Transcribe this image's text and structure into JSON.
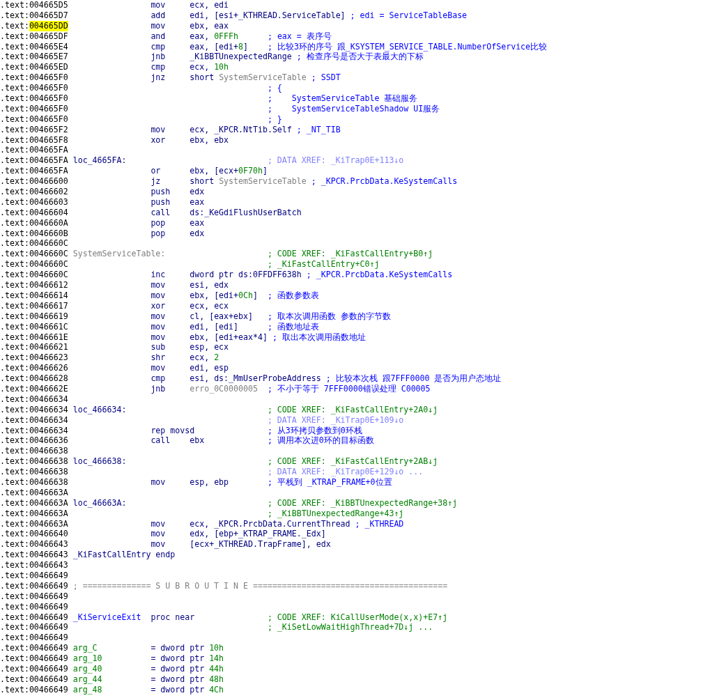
{
  "lines": [
    {
      "addr": ".text:004665D5",
      "highlighted": false,
      "parts": [
        {
          "kind": "mnem",
          "text": "mov"
        },
        {
          "kind": "op",
          "text": "ecx, edi"
        }
      ]
    },
    {
      "addr": ".text:004665D7",
      "highlighted": false,
      "parts": [
        {
          "kind": "mnem",
          "text": "add"
        },
        {
          "kind": "op",
          "text": "edi, [esi+_KTHREAD.ServiceTable]"
        },
        {
          "kind": "cmt",
          "text": "; edi = ServiceTableBase"
        }
      ]
    },
    {
      "addr": ".text:004665DD",
      "highlighted": true,
      "parts": [
        {
          "kind": "mnem",
          "text": "mov"
        },
        {
          "kind": "op",
          "text": "ebx, eax"
        }
      ]
    },
    {
      "addr": ".text:004665DF",
      "highlighted": false,
      "parts": [
        {
          "kind": "mnem",
          "text": "and"
        },
        {
          "kind": "op",
          "text": "eax, "
        },
        {
          "kind": "num",
          "text": "0FFFh"
        },
        {
          "kind": "cmt",
          "text": "; eax = 表序号"
        }
      ]
    },
    {
      "addr": ".text:004665E4",
      "highlighted": false,
      "parts": [
        {
          "kind": "mnem",
          "text": "cmp"
        },
        {
          "kind": "op",
          "text": "eax, [edi+"
        },
        {
          "kind": "num",
          "text": "8"
        },
        {
          "kind": "op",
          "text": "]"
        },
        {
          "kind": "cmt",
          "text": "; 比较3环的序号 跟_KSYSTEM_SERVICE_TABLE.NumberOfService比较"
        }
      ]
    },
    {
      "addr": ".text:004665E7",
      "highlighted": false,
      "parts": [
        {
          "kind": "mnem",
          "text": "jnb"
        },
        {
          "kind": "op",
          "text": "_KiBBTUnexpectedRange"
        },
        {
          "kind": "cmt",
          "text": "; 检查序号是否大于表最大的下标"
        }
      ]
    },
    {
      "addr": ".text:004665ED",
      "highlighted": false,
      "parts": [
        {
          "kind": "mnem",
          "text": "cmp"
        },
        {
          "kind": "op",
          "text": "ecx, "
        },
        {
          "kind": "num",
          "text": "10h"
        }
      ]
    },
    {
      "addr": ".text:004665F0",
      "highlighted": false,
      "parts": [
        {
          "kind": "mnem",
          "text": "jnz"
        },
        {
          "kind": "op",
          "text": "short "
        },
        {
          "kind": "name",
          "text": "SystemServiceTable"
        },
        {
          "kind": "cmt",
          "text": "; SSDT"
        }
      ]
    },
    {
      "addr": ".text:004665F0",
      "highlighted": false,
      "parts": [
        {
          "kind": "cmt",
          "text": "; {"
        }
      ]
    },
    {
      "addr": ".text:004665F0",
      "highlighted": false,
      "parts": [
        {
          "kind": "cmt",
          "text": ";    SystemServiceTable 基础服务"
        }
      ]
    },
    {
      "addr": ".text:004665F0",
      "highlighted": false,
      "parts": [
        {
          "kind": "cmt",
          "text": ";    SystemServiceTableShadow UI服务"
        }
      ]
    },
    {
      "addr": ".text:004665F0",
      "highlighted": false,
      "parts": [
        {
          "kind": "cmt",
          "text": "; }"
        }
      ]
    },
    {
      "addr": ".text:004665F2",
      "highlighted": false,
      "parts": [
        {
          "kind": "mnem",
          "text": "mov"
        },
        {
          "kind": "op",
          "text": "ecx, _KPCR.NtTib.Self"
        },
        {
          "kind": "cmt",
          "text": "; _NT_TIB"
        }
      ]
    },
    {
      "addr": ".text:004665F8",
      "highlighted": false,
      "parts": [
        {
          "kind": "mnem",
          "text": "xor"
        },
        {
          "kind": "op",
          "text": "ebx, ebx"
        }
      ]
    },
    {
      "addr": ".text:004665FA",
      "highlighted": false
    },
    {
      "addr": ".text:004665FA",
      "highlighted": false,
      "parts": [
        {
          "kind": "label",
          "text": "loc_4665FA:"
        },
        {
          "kind": "dxref",
          "text": "; DATA XREF: _KiTrap0E+113↓o"
        }
      ]
    },
    {
      "addr": ".text:004665FA",
      "highlighted": false,
      "parts": [
        {
          "kind": "mnem",
          "text": "or"
        },
        {
          "kind": "op",
          "text": "ebx, [ecx+"
        },
        {
          "kind": "num",
          "text": "0F70h"
        },
        {
          "kind": "op",
          "text": "]"
        }
      ]
    },
    {
      "addr": ".text:00466600",
      "highlighted": false,
      "parts": [
        {
          "kind": "mnem",
          "text": "jz"
        },
        {
          "kind": "op",
          "text": "short "
        },
        {
          "kind": "name",
          "text": "SystemServiceTable"
        },
        {
          "kind": "cmt",
          "text": "; _KPCR.PrcbData.KeSystemCalls"
        }
      ]
    },
    {
      "addr": ".text:00466602",
      "highlighted": false,
      "parts": [
        {
          "kind": "mnem",
          "text": "push"
        },
        {
          "kind": "op",
          "text": "edx"
        }
      ]
    },
    {
      "addr": ".text:00466603",
      "highlighted": false,
      "parts": [
        {
          "kind": "mnem",
          "text": "push"
        },
        {
          "kind": "op",
          "text": "eax"
        }
      ]
    },
    {
      "addr": ".text:00466604",
      "highlighted": false,
      "parts": [
        {
          "kind": "mnem",
          "text": "call"
        },
        {
          "kind": "op",
          "text": "ds:_KeGdiFlushUserBatch"
        }
      ]
    },
    {
      "addr": ".text:0046660A",
      "highlighted": false,
      "parts": [
        {
          "kind": "mnem",
          "text": "pop"
        },
        {
          "kind": "op",
          "text": "eax"
        }
      ]
    },
    {
      "addr": ".text:0046660B",
      "highlighted": false,
      "parts": [
        {
          "kind": "mnem",
          "text": "pop"
        },
        {
          "kind": "op",
          "text": "edx"
        }
      ]
    },
    {
      "addr": ".text:0046660C",
      "highlighted": false
    },
    {
      "addr": ".text:0046660C",
      "highlighted": false,
      "parts": [
        {
          "kind": "label_gray",
          "text": "SystemServiceTable:"
        },
        {
          "kind": "xref",
          "text": "; CODE XREF: _KiFastCallEntry+B0↑j"
        }
      ]
    },
    {
      "addr": ".text:0046660C",
      "highlighted": false,
      "parts": [
        {
          "kind": "xref",
          "text": "; _KiFastCallEntry+C0↑j"
        }
      ]
    },
    {
      "addr": ".text:0046660C",
      "highlighted": false,
      "parts": [
        {
          "kind": "mnem",
          "text": "inc"
        },
        {
          "kind": "op",
          "text": "dword ptr ds:0FFDFF638h"
        },
        {
          "kind": "cmt",
          "text": "; _KPCR.PrcbData.KeSystemCalls"
        }
      ]
    },
    {
      "addr": ".text:00466612",
      "highlighted": false,
      "parts": [
        {
          "kind": "mnem",
          "text": "mov"
        },
        {
          "kind": "op",
          "text": "esi, edx"
        }
      ]
    },
    {
      "addr": ".text:00466614",
      "highlighted": false,
      "parts": [
        {
          "kind": "mnem",
          "text": "mov"
        },
        {
          "kind": "op",
          "text": "ebx, [edi+"
        },
        {
          "kind": "num",
          "text": "0Ch"
        },
        {
          "kind": "op",
          "text": "]"
        },
        {
          "kind": "cmt",
          "text": "; 函数参数表"
        }
      ]
    },
    {
      "addr": ".text:00466617",
      "highlighted": false,
      "parts": [
        {
          "kind": "mnem",
          "text": "xor"
        },
        {
          "kind": "op",
          "text": "ecx, ecx"
        }
      ]
    },
    {
      "addr": ".text:00466619",
      "highlighted": false,
      "parts": [
        {
          "kind": "mnem",
          "text": "mov"
        },
        {
          "kind": "op",
          "text": "cl, [eax+ebx]"
        },
        {
          "kind": "cmt",
          "text": "; 取本次调用函数 参数的字节数"
        }
      ]
    },
    {
      "addr": ".text:0046661C",
      "highlighted": false,
      "parts": [
        {
          "kind": "mnem",
          "text": "mov"
        },
        {
          "kind": "op",
          "text": "edi, [edi]"
        },
        {
          "kind": "cmt",
          "text": "; 函数地址表"
        }
      ]
    },
    {
      "addr": ".text:0046661E",
      "highlighted": false,
      "parts": [
        {
          "kind": "mnem",
          "text": "mov"
        },
        {
          "kind": "op",
          "text": "ebx, [edi+eax*4]"
        },
        {
          "kind": "cmt",
          "text": "; 取出本次调用函数地址"
        }
      ]
    },
    {
      "addr": ".text:00466621",
      "highlighted": false,
      "parts": [
        {
          "kind": "mnem",
          "text": "sub"
        },
        {
          "kind": "op",
          "text": "esp, ecx"
        }
      ]
    },
    {
      "addr": ".text:00466623",
      "highlighted": false,
      "parts": [
        {
          "kind": "mnem",
          "text": "shr"
        },
        {
          "kind": "op",
          "text": "ecx, "
        },
        {
          "kind": "num",
          "text": "2"
        }
      ]
    },
    {
      "addr": ".text:00466626",
      "highlighted": false,
      "parts": [
        {
          "kind": "mnem",
          "text": "mov"
        },
        {
          "kind": "op",
          "text": "edi, esp"
        }
      ]
    },
    {
      "addr": ".text:00466628",
      "highlighted": false,
      "parts": [
        {
          "kind": "mnem",
          "text": "cmp"
        },
        {
          "kind": "op",
          "text": "esi, ds:_MmUserProbeAddress"
        },
        {
          "kind": "cmt",
          "text": "; 比较本次栈 跟7FFF0000 是否为用户态地址"
        }
      ]
    },
    {
      "addr": ".text:0046662E",
      "highlighted": false,
      "parts": [
        {
          "kind": "mnem",
          "text": "jnb"
        },
        {
          "kind": "name",
          "text": "erro_0C0000005"
        },
        {
          "kind": "cmt",
          "text": "; 不小于等于 7FFF0000错误处理 C00005"
        }
      ]
    },
    {
      "addr": ".text:00466634",
      "highlighted": false
    },
    {
      "addr": ".text:00466634",
      "highlighted": false,
      "parts": [
        {
          "kind": "label",
          "text": "loc_466634:"
        },
        {
          "kind": "xref",
          "text": "; CODE XREF: _KiFastCallEntry+2A0↓j"
        }
      ]
    },
    {
      "addr": ".text:00466634",
      "highlighted": false,
      "parts": [
        {
          "kind": "dxref",
          "text": "; DATA XREF: _KiTrap0E+109↓o"
        }
      ]
    },
    {
      "addr": ".text:00466634",
      "highlighted": false,
      "parts": [
        {
          "kind": "mnem",
          "text": "rep movsd"
        },
        {
          "kind": "cmt",
          "text": "; 从3环拷贝参数到0环栈"
        }
      ]
    },
    {
      "addr": ".text:00466636",
      "highlighted": false,
      "parts": [
        {
          "kind": "mnem",
          "text": "call"
        },
        {
          "kind": "op",
          "text": "ebx"
        },
        {
          "kind": "cmt",
          "text": "; 调用本次进0环的目标函数"
        }
      ]
    },
    {
      "addr": ".text:00466638",
      "highlighted": false
    },
    {
      "addr": ".text:00466638",
      "highlighted": false,
      "parts": [
        {
          "kind": "label",
          "text": "loc_466638:"
        },
        {
          "kind": "xref",
          "text": "; CODE XREF: _KiFastCallEntry+2AB↓j"
        }
      ]
    },
    {
      "addr": ".text:00466638",
      "highlighted": false,
      "parts": [
        {
          "kind": "dxref",
          "text": "; DATA XREF: _KiTrap0E+129↓o ..."
        }
      ]
    },
    {
      "addr": ".text:00466638",
      "highlighted": false,
      "parts": [
        {
          "kind": "mnem",
          "text": "mov"
        },
        {
          "kind": "op",
          "text": "esp, ebp"
        },
        {
          "kind": "cmt",
          "text": "; 平栈到 _KTRAP_FRAME+0位置"
        }
      ]
    },
    {
      "addr": ".text:0046663A",
      "highlighted": false
    },
    {
      "addr": ".text:0046663A",
      "highlighted": false,
      "parts": [
        {
          "kind": "label",
          "text": "loc_46663A:"
        },
        {
          "kind": "xref",
          "text": "; CODE XREF: _KiBBTUnexpectedRange+38↑j"
        }
      ]
    },
    {
      "addr": ".text:0046663A",
      "highlighted": false,
      "parts": [
        {
          "kind": "xref",
          "text": "; _KiBBTUnexpectedRange+43↑j"
        }
      ]
    },
    {
      "addr": ".text:0046663A",
      "highlighted": false,
      "parts": [
        {
          "kind": "mnem",
          "text": "mov"
        },
        {
          "kind": "op",
          "text": "ecx, _KPCR.PrcbData.CurrentThread"
        },
        {
          "kind": "cmt",
          "text": "; _KTHREAD"
        }
      ]
    },
    {
      "addr": ".text:00466640",
      "highlighted": false,
      "parts": [
        {
          "kind": "mnem",
          "text": "mov"
        },
        {
          "kind": "op",
          "text": "edx, [ebp+_KTRAP_FRAME._Edx]"
        }
      ]
    },
    {
      "addr": ".text:00466643",
      "highlighted": false,
      "parts": [
        {
          "kind": "mnem",
          "text": "mov"
        },
        {
          "kind": "op",
          "text": "[ecx+_KTHREAD.TrapFrame], edx"
        }
      ]
    },
    {
      "addr": ".text:00466643",
      "highlighted": false,
      "parts": [
        {
          "kind": "label",
          "text": "_KiFastCallEntry"
        },
        {
          "kind": "mnem",
          "text": "endp"
        }
      ]
    },
    {
      "addr": ".text:00466643",
      "highlighted": false
    },
    {
      "addr": ".text:00466649",
      "highlighted": false
    },
    {
      "addr": ".text:00466649",
      "highlighted": false,
      "parts": [
        {
          "kind": "sep",
          "text": "; ============== S U B R O U T I N E ========================================"
        }
      ]
    },
    {
      "addr": ".text:00466649",
      "highlighted": false
    },
    {
      "addr": ".text:00466649",
      "highlighted": false
    },
    {
      "addr": ".text:00466649",
      "highlighted": false,
      "parts": [
        {
          "kind": "proc",
          "text": "_KiServiceExit"
        },
        {
          "kind": "mnem",
          "text": "proc near"
        },
        {
          "kind": "xref",
          "text": "; CODE XREF: KiCallUserMode(x,x)+E7↑j"
        }
      ]
    },
    {
      "addr": ".text:00466649",
      "highlighted": false,
      "parts": [
        {
          "kind": "xref",
          "text": "; _KiSetLowWaitHighThread+7D↓j ..."
        }
      ]
    },
    {
      "addr": ".text:00466649",
      "highlighted": false
    },
    {
      "addr": ".text:00466649",
      "highlighted": false,
      "parts": [
        {
          "kind": "arg",
          "text": "arg_C"
        },
        {
          "kind": "mnem",
          "text": "= dword ptr"
        },
        {
          "kind": "num",
          "text": "10h"
        }
      ]
    },
    {
      "addr": ".text:00466649",
      "highlighted": false,
      "parts": [
        {
          "kind": "arg",
          "text": "arg_10"
        },
        {
          "kind": "mnem",
          "text": "= dword ptr"
        },
        {
          "kind": "num",
          "text": "14h"
        }
      ]
    },
    {
      "addr": ".text:00466649",
      "highlighted": false,
      "parts": [
        {
          "kind": "arg",
          "text": "arg_40"
        },
        {
          "kind": "mnem",
          "text": "= dword ptr"
        },
        {
          "kind": "num",
          "text": "44h"
        }
      ]
    },
    {
      "addr": ".text:00466649",
      "highlighted": false,
      "parts": [
        {
          "kind": "arg",
          "text": "arg_44"
        },
        {
          "kind": "mnem",
          "text": "= dword ptr"
        },
        {
          "kind": "num",
          "text": "48h"
        }
      ]
    },
    {
      "addr": ".text:00466649",
      "highlighted": false,
      "parts": [
        {
          "kind": "arg",
          "text": "arg_48"
        },
        {
          "kind": "mnem",
          "text": "= dword ptr"
        },
        {
          "kind": "num",
          "text": "4Ch"
        }
      ]
    }
  ]
}
